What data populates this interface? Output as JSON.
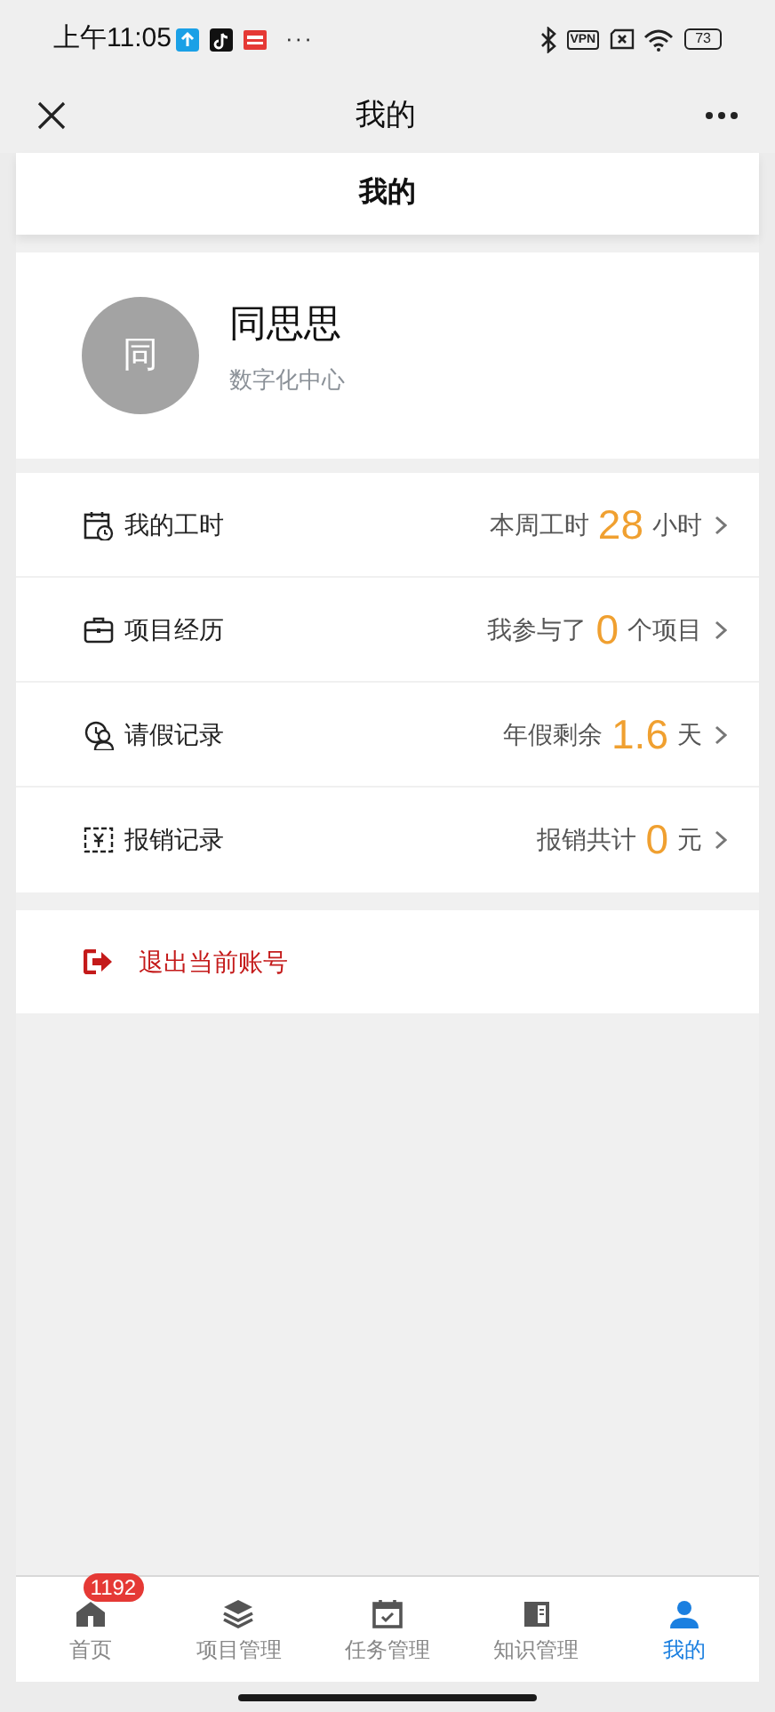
{
  "status_bar": {
    "time": "上午11:05",
    "more": "···",
    "vpn": "VPN",
    "battery": "73"
  },
  "nav_bar": {
    "title": "我的"
  },
  "page_header": {
    "title": "我的"
  },
  "profile": {
    "avatar_text": "同",
    "name": "同思思",
    "department": "数字化中心"
  },
  "menu": [
    {
      "kind": "hours",
      "label": "我的工时",
      "prefix": "本周工时",
      "value": "28",
      "suffix": "小时"
    },
    {
      "kind": "projects",
      "label": "项目经历",
      "prefix": "我参与了",
      "value": "0",
      "suffix": "个项目"
    },
    {
      "kind": "leave",
      "label": "请假记录",
      "prefix": "年假剩余",
      "value": "1.6",
      "suffix": "天"
    },
    {
      "kind": "expense",
      "label": "报销记录",
      "prefix": "报销共计",
      "value": "0",
      "suffix": "元"
    }
  ],
  "logout": {
    "label": "退出当前账号"
  },
  "tab_bar": [
    {
      "kind": "home",
      "label": "首页",
      "badge": "1192",
      "selected": false
    },
    {
      "kind": "projects",
      "label": "项目管理",
      "selected": false
    },
    {
      "kind": "tasks",
      "label": "任务管理",
      "selected": false
    },
    {
      "kind": "knowledge",
      "label": "知识管理",
      "selected": false
    },
    {
      "kind": "me",
      "label": "我的",
      "selected": true
    }
  ]
}
